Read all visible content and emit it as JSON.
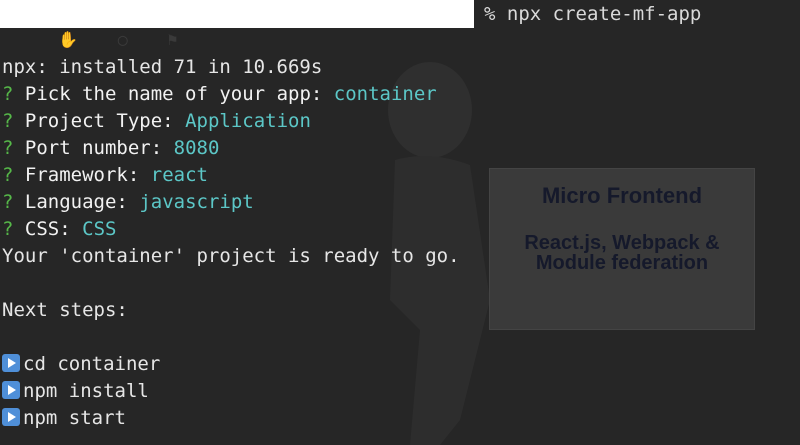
{
  "prompt_command": "% npx create-mf-app",
  "terminal": {
    "install_line": "npx: installed 71 in 10.669s",
    "questions": [
      {
        "mark": "?",
        "label": "Pick the name of your app:",
        "answer": "container"
      },
      {
        "mark": "?",
        "label": "Project Type:",
        "answer": "Application"
      },
      {
        "mark": "?",
        "label": "Port number:",
        "answer": "8080"
      },
      {
        "mark": "?",
        "label": "Framework:",
        "answer": "react"
      },
      {
        "mark": "?",
        "label": "Language:",
        "answer": "javascript"
      },
      {
        "mark": "?",
        "label": "CSS:",
        "answer": "CSS"
      }
    ],
    "ready_line": "Your 'container' project is ready to go.",
    "next_steps_label": "Next steps:",
    "steps": [
      "cd container",
      "npm install",
      "npm start"
    ]
  },
  "background_sign": {
    "title": "Micro Frontend",
    "subtitle": "React.js, Webpack & Module federation"
  },
  "colors": {
    "background": "#262626",
    "question_mark": "#56b849",
    "answer": "#5cc7c7",
    "text": "#e6e6e6",
    "step_icon": "#4f8fd8"
  }
}
